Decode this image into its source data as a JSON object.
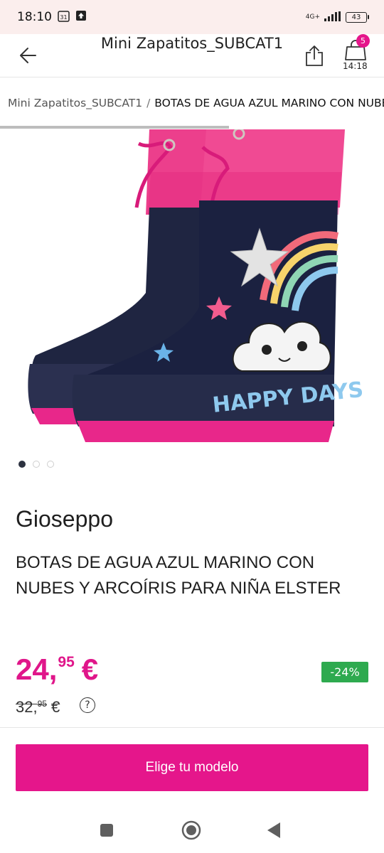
{
  "status_bar": {
    "time": "18:10",
    "calendar_day": "31",
    "network": "4G+",
    "battery": "43"
  },
  "header": {
    "title": "Mini Zapatitos_SUBCAT1",
    "cart_count": "5",
    "cart_time": "14:18"
  },
  "breadcrumb": {
    "parent": "Mini Zapatitos_SUBCAT1",
    "separator": "/",
    "current": "BOTAS DE AGUA AZUL MARINO CON NUBES Y ARCOÍRIS PARA NIÑA ELSTER"
  },
  "gallery": {
    "image_count": 3,
    "active_index": 0,
    "image_text": "HAPPY DAYS"
  },
  "product": {
    "brand": "Gioseppo",
    "name": "BOTAS DE AGUA AZUL MARINO CON NUBES Y ARCOÍRIS PARA NIÑA ELSTER",
    "price_int": "24,",
    "price_dec": "95",
    "currency": "€",
    "old_price_int": "32,",
    "old_price_dec": "95",
    "discount": "-24%",
    "help": "?"
  },
  "cta": {
    "label": "Elige tu modelo"
  },
  "colors": {
    "accent": "#e5168b",
    "discount_green": "#2eaa4f",
    "status_bar_bg": "#fbeeed",
    "boot_navy": "#1f2541"
  }
}
